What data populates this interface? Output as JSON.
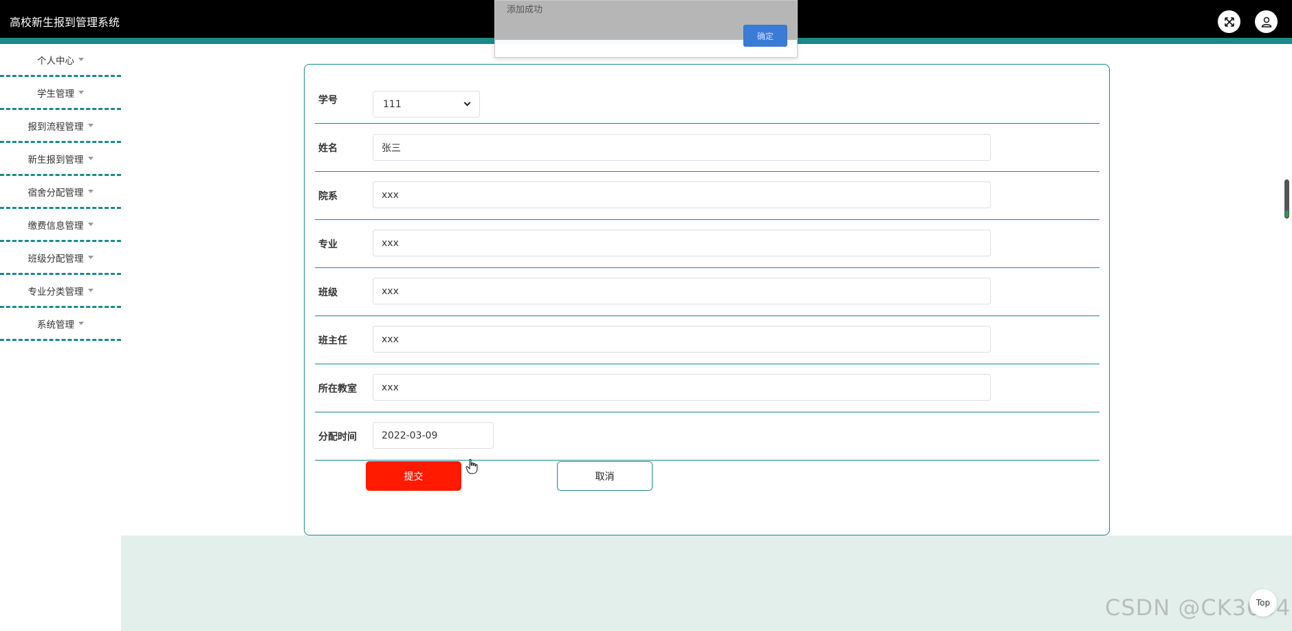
{
  "app": {
    "title": "高校新生报到管理系统"
  },
  "header": {
    "fullscreen_icon": "expand-icon",
    "user_icon": "user-icon"
  },
  "sidebar": {
    "items": [
      {
        "label": "个人中心"
      },
      {
        "label": "学生管理"
      },
      {
        "label": "报到流程管理"
      },
      {
        "label": "新生报到管理"
      },
      {
        "label": "宿舍分配管理"
      },
      {
        "label": "缴费信息管理"
      },
      {
        "label": "班级分配管理"
      },
      {
        "label": "专业分类管理"
      },
      {
        "label": "系统管理"
      }
    ]
  },
  "form": {
    "fields": [
      {
        "label": "学号",
        "value": "111"
      },
      {
        "label": "姓名",
        "value": "张三"
      },
      {
        "label": "院系",
        "value": "xxx"
      },
      {
        "label": "专业",
        "value": "xxx"
      },
      {
        "label": "班级",
        "value": "xxx"
      },
      {
        "label": "班主任",
        "value": "xxx"
      },
      {
        "label": "所在教室",
        "value": "xxx"
      },
      {
        "label": "分配时间",
        "value": "2022-03-09"
      }
    ],
    "submit_label": "提交",
    "cancel_label": "取消"
  },
  "toast": {
    "message": "添加成功",
    "ok_label": "确定"
  },
  "back_to_top_label": "Top",
  "watermark": "CSDN @CK3034",
  "colors": {
    "accent": "#1a8a8c",
    "submit": "#ff1a00",
    "header": "#000000",
    "footer": "#e3efeb",
    "toast_button": "#3a7bd5"
  }
}
